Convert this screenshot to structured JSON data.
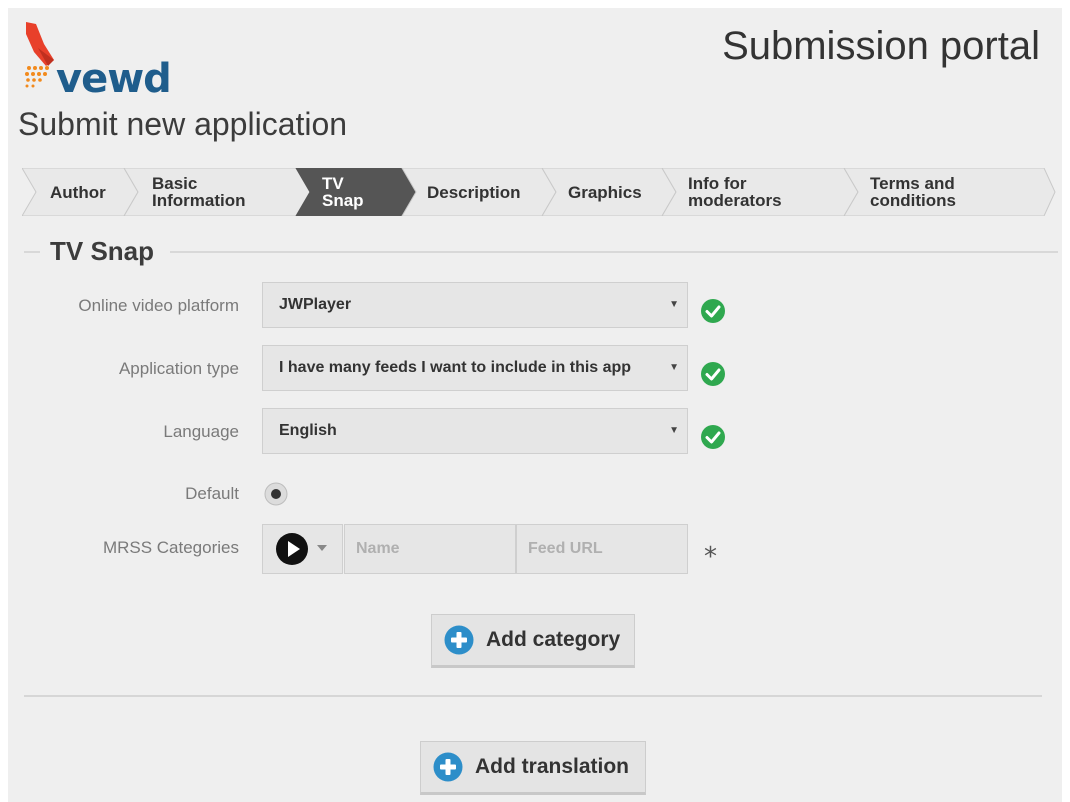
{
  "header": {
    "logo_text": "vewd",
    "portal_title": "Submission portal",
    "page_title": "Submit new application"
  },
  "steps": [
    {
      "label_line1": "Author",
      "label_line2": "",
      "active": false
    },
    {
      "label_line1": "Basic",
      "label_line2": "Information",
      "active": false
    },
    {
      "label_line1": "TV",
      "label_line2": "Snap",
      "active": true
    },
    {
      "label_line1": "Description",
      "label_line2": "",
      "active": false
    },
    {
      "label_line1": "Graphics",
      "label_line2": "",
      "active": false
    },
    {
      "label_line1": "Info for",
      "label_line2": "moderators",
      "active": false
    },
    {
      "label_line1": "Terms and",
      "label_line2": "conditions",
      "active": false
    }
  ],
  "section": {
    "legend": "TV Snap"
  },
  "fields": {
    "platform": {
      "label": "Online video platform",
      "value": "JWPlayer",
      "valid": true
    },
    "app_type": {
      "label": "Application type",
      "value": "I have many feeds I want to include in this app",
      "valid": true
    },
    "language": {
      "label": "Language",
      "value": "English",
      "valid": true
    },
    "default": {
      "label": "Default",
      "selected": true
    },
    "mrss": {
      "label": "MRSS Categories",
      "icon": "play-circle-icon",
      "name_placeholder": "Name",
      "url_placeholder": "Feed URL",
      "required_mark": "*"
    }
  },
  "buttons": {
    "add_category": "Add category",
    "add_translation": "Add translation"
  },
  "colors": {
    "active_step": "#555555",
    "check_green": "#2fa84f",
    "plus_blue": "#2d8ec9",
    "logo_blue": "#1f5d8c",
    "logo_red": "#e8402a",
    "logo_orange": "#f28a1d"
  }
}
